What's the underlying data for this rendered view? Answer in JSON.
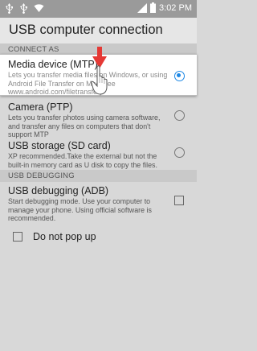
{
  "status_bar": {
    "time": "3:02",
    "ampm": "PM",
    "left_icons": [
      "usb-icon",
      "usb-icon",
      "wifi-icon"
    ],
    "right_icons": [
      "signal-icon",
      "battery-icon"
    ]
  },
  "header": {
    "title": "USB computer connection"
  },
  "sections": {
    "connect_as": "CONNECT AS",
    "usb_debugging": "USB DEBUGGING"
  },
  "options": {
    "mtp": {
      "label": "Media device (MTP)",
      "desc": "Lets you transfer media files on Windows, or using Android File Transfer on Mac (see www.android.com/filetransfer)",
      "selected": true
    },
    "ptp": {
      "label": "Camera (PTP)",
      "desc": "Lets you transfer photos using camera software, and transfer any files on computers that don't support MTP",
      "selected": false
    },
    "storage": {
      "label": "USB storage (SD card)",
      "desc": "XP recommended.Take the external but not the built-in memory card as U disk to copy the files.",
      "selected": false
    }
  },
  "debugging": {
    "label": "USB debugging (ADB)",
    "desc": "Start debugging mode. Use your computer to manage your phone. Using official software is recommended.",
    "checked": false
  },
  "do_not_popup": {
    "label": "Do not pop up",
    "checked": false
  },
  "colors": {
    "accent": "#1e88e5",
    "annotation": "#e53935"
  },
  "annotations": [
    "red-arrow-icon",
    "tapping-hand-icon"
  ]
}
